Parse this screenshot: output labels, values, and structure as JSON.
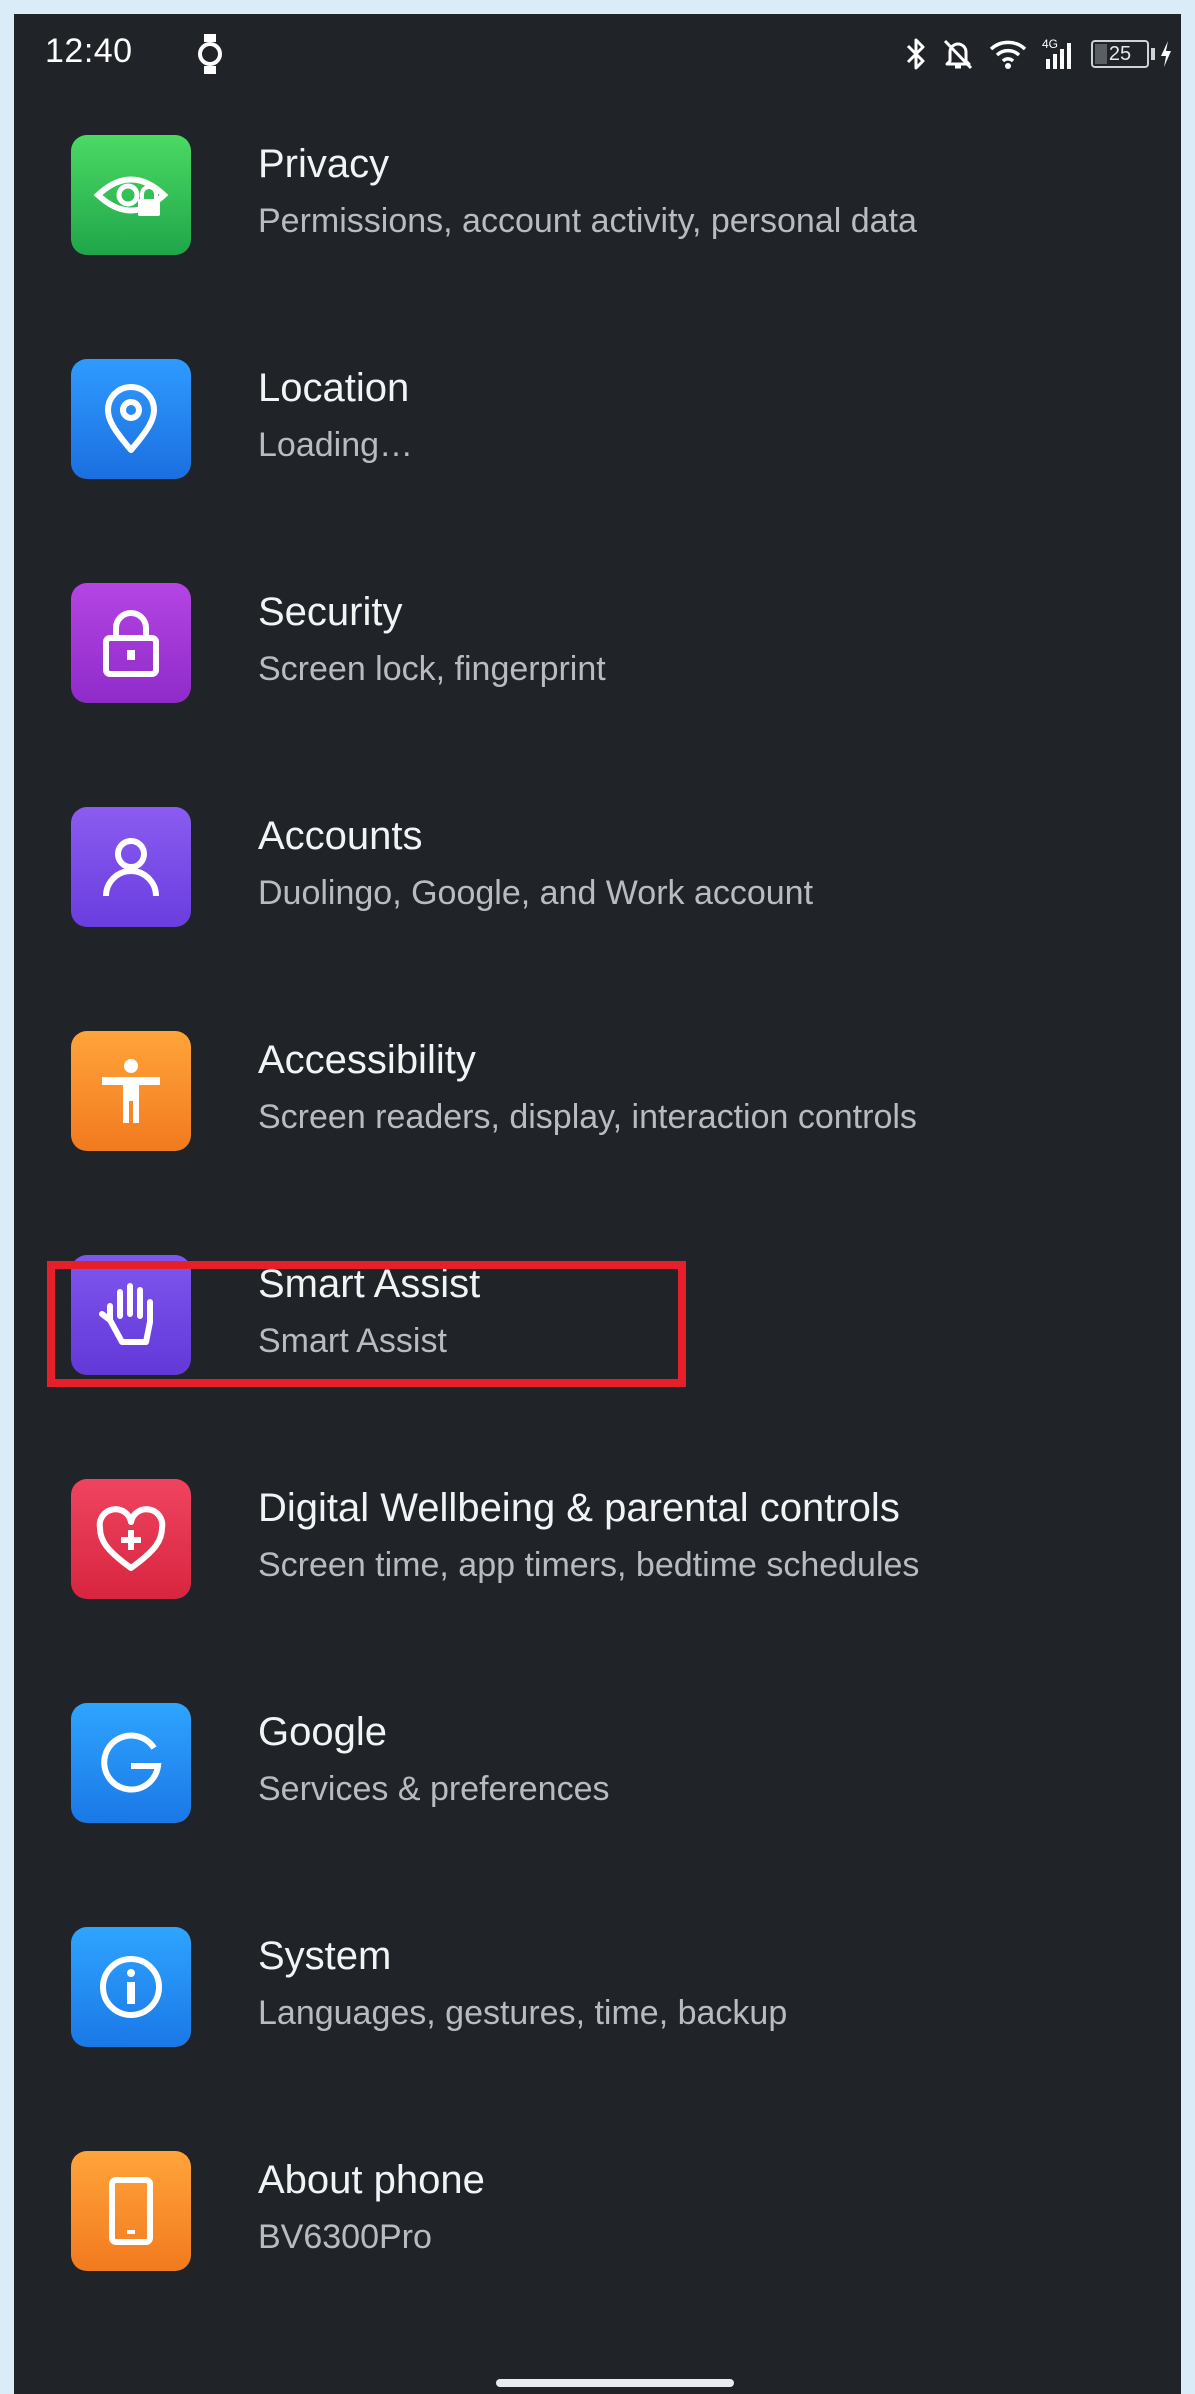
{
  "status_bar": {
    "time": "12:40",
    "network_label": "4G",
    "battery_level": "25",
    "icons": [
      "smartwatch-icon",
      "bluetooth-icon",
      "alarm-off-icon",
      "wifi-icon",
      "cell-signal-icon",
      "battery-icon",
      "charging-icon"
    ]
  },
  "settings": {
    "items": [
      {
        "title": "Privacy",
        "subtitle": "Permissions, account activity, personal data",
        "icon": "privacy-eye-icon",
        "color_top": "#4cd964",
        "color_bottom": "#1fa64a"
      },
      {
        "title": "Location",
        "subtitle": "Loading…",
        "icon": "location-pin-icon",
        "color_top": "#2f9bff",
        "color_bottom": "#1b6fe0"
      },
      {
        "title": "Security",
        "subtitle": "Screen lock, fingerprint",
        "icon": "lock-icon",
        "color_top": "#b445e4",
        "color_bottom": "#8f2bc9"
      },
      {
        "title": "Accounts",
        "subtitle": "Duolingo, Google, and Work account",
        "icon": "person-icon",
        "color_top": "#8a5cf0",
        "color_bottom": "#6a3de0"
      },
      {
        "title": "Accessibility",
        "subtitle": "Screen readers, display, interaction controls",
        "icon": "accessibility-icon",
        "color_top": "#ffa43a",
        "color_bottom": "#f27a1f"
      },
      {
        "title": "Smart Assist",
        "subtitle": "Smart Assist",
        "icon": "hand-icon",
        "color_top": "#7f56ee",
        "color_bottom": "#6238d8"
      },
      {
        "title": "Digital Wellbeing & parental controls",
        "subtitle": "Screen time, app timers, bedtime schedules",
        "icon": "heart-plus-icon",
        "color_top": "#ef4460",
        "color_bottom": "#d8253f"
      },
      {
        "title": "Google",
        "subtitle": "Services & preferences",
        "icon": "google-g-icon",
        "color_top": "#2fa4ff",
        "color_bottom": "#1a78e6"
      },
      {
        "title": "System",
        "subtitle": "Languages, gestures, time, backup",
        "icon": "info-icon",
        "color_top": "#2fa4ff",
        "color_bottom": "#1a78e6"
      },
      {
        "title": "About phone",
        "subtitle": "BV6300Pro",
        "icon": "phone-icon",
        "color_top": "#ffa43a",
        "color_bottom": "#f27a1f"
      }
    ]
  },
  "highlight": {
    "target": "Smart Assist",
    "color": "#e5202b"
  },
  "colors": {
    "background": "#202428",
    "title_text": "#f1f3f4",
    "subtitle_text": "#b7bcc0",
    "frame": "#d9ecf7"
  }
}
